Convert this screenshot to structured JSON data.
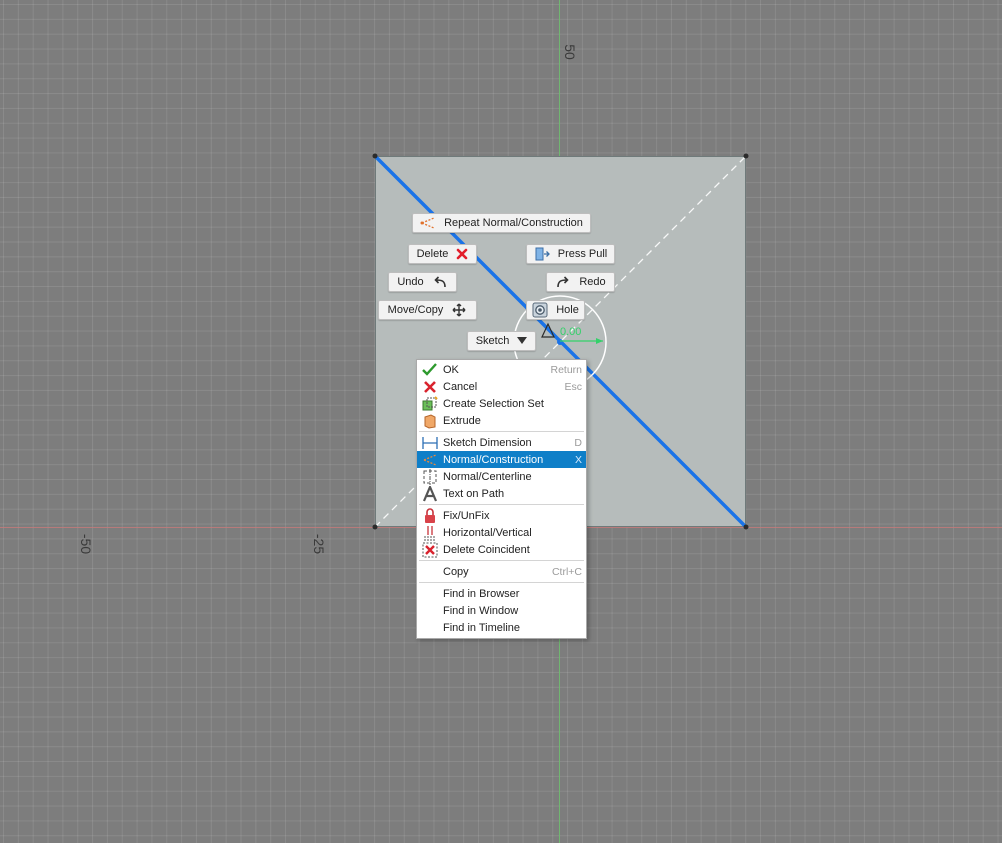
{
  "canvas": {
    "axis_labels": {
      "top": "50",
      "left_far": "-50",
      "left_near": "-25"
    },
    "colors": {
      "background": "#7d7d7d",
      "sketch_fill": "#b6bcbb",
      "line": "#1a73e8",
      "selection": "#0f7fc8"
    },
    "dimension_text": "0.00"
  },
  "marking_menu": {
    "repeat": "Repeat Normal/Construction",
    "delete": "Delete",
    "press_pull": "Press Pull",
    "undo": "Undo",
    "redo": "Redo",
    "move_copy": "Move/Copy",
    "hole": "Hole",
    "sketch": "Sketch"
  },
  "context_menu": {
    "groups": [
      [
        {
          "label": "OK",
          "shortcut": "Return",
          "icon": "checkmark-icon"
        },
        {
          "label": "Cancel",
          "shortcut": "Esc",
          "icon": "cancel-x-icon"
        },
        {
          "label": "Create Selection Set",
          "shortcut": "",
          "icon": "selection-set-icon"
        },
        {
          "label": "Extrude",
          "shortcut": "",
          "icon": "extrude-icon"
        }
      ],
      [
        {
          "label": "Sketch Dimension",
          "shortcut": "D",
          "icon": "sketch-dimension-icon"
        },
        {
          "label": "Normal/Construction",
          "shortcut": "X",
          "icon": "construction-line-icon",
          "selected": true
        },
        {
          "label": "Normal/Centerline",
          "shortcut": "",
          "icon": "centerline-icon"
        },
        {
          "label": "Text on Path",
          "shortcut": "",
          "icon": "text-on-path-icon"
        }
      ],
      [
        {
          "label": "Fix/UnFix",
          "shortcut": "",
          "icon": "lock-icon"
        },
        {
          "label": "Horizontal/Vertical",
          "shortcut": "",
          "icon": "horizontal-vertical-icon"
        },
        {
          "label": "Delete Coincident",
          "shortcut": "",
          "icon": "delete-coincident-icon"
        }
      ],
      [
        {
          "label": "Copy",
          "shortcut": "Ctrl+C",
          "icon": ""
        }
      ],
      [
        {
          "label": "Find in Browser",
          "shortcut": "",
          "icon": ""
        },
        {
          "label": "Find in Window",
          "shortcut": "",
          "icon": ""
        },
        {
          "label": "Find in Timeline",
          "shortcut": "",
          "icon": ""
        }
      ]
    ]
  }
}
